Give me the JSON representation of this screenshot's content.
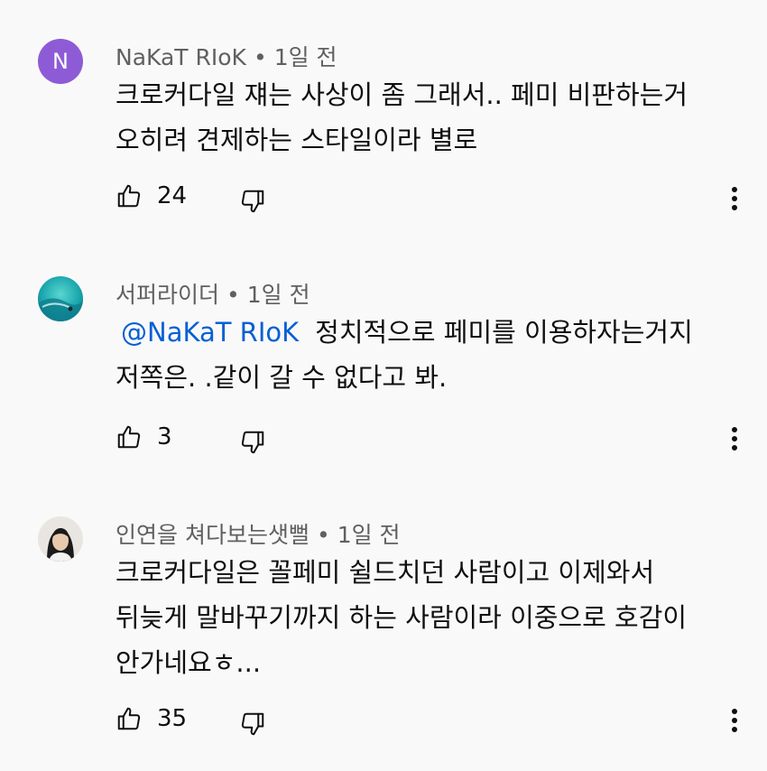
{
  "comments": [
    {
      "avatar_letter": "N",
      "avatar_color": "#8e5bd6",
      "author": "NaKaT RIoK",
      "separator": "•",
      "time": "1일 전",
      "lines": [
        "크로커다일 쟤는 사상이 좀 그래서.. 페미 비판하는거",
        "오히려 견제하는 스타일이라 별로"
      ],
      "likes": "24"
    },
    {
      "avatar_kind": "ocean-wave-photo",
      "author": "서퍼라이더",
      "separator": "•",
      "time": "1일 전",
      "mention": "@NaKaT RIoK",
      "lines": [
        "정치적으로 페미를 이용하자는거지",
        "저쪽은. .같이 갈 수 없다고 봐."
      ],
      "likes": "3"
    },
    {
      "avatar_kind": "person-photo",
      "author": "인연을 쳐다보는샛뻘",
      "separator": "•",
      "time": "1일 전",
      "lines": [
        "크로커다일은 꼴페미 쉴드치던 사람이고 이제와서",
        "뒤늦게 말바꾸기까지 하는 사람이라 이중으로 호감이",
        "안가네요ㅎ..."
      ],
      "likes": "35"
    }
  ],
  "icons": {
    "like": "thumbs-up-icon",
    "dislike": "thumbs-down-icon",
    "more": "more-vertical-icon"
  },
  "colors": {
    "background": "#f9f9f9",
    "meta_text": "#606060",
    "mention": "#065fd4"
  }
}
